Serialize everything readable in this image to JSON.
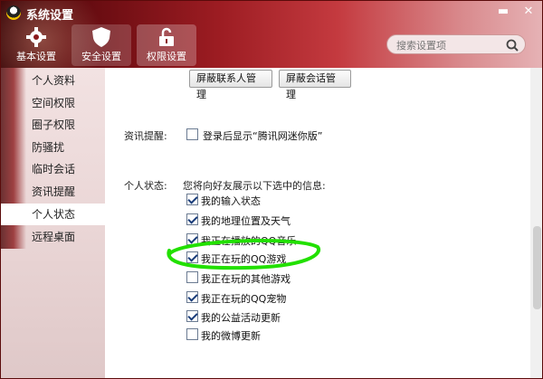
{
  "window": {
    "title": "系统设置"
  },
  "controls": {
    "minimize": "▬",
    "close": "✕"
  },
  "topnav": [
    {
      "label": "基本设置",
      "icon": "gear-icon"
    },
    {
      "label": "安全设置",
      "icon": "shield-icon"
    },
    {
      "label": "权限设置",
      "icon": "lock-icon"
    }
  ],
  "search": {
    "placeholder": "搜索设置项",
    "icon": "search-icon"
  },
  "sidebar": {
    "items": [
      {
        "label": "个人资料"
      },
      {
        "label": "空间权限"
      },
      {
        "label": "圈子权限"
      },
      {
        "label": "防骚扰"
      },
      {
        "label": "临时会话"
      },
      {
        "label": "资讯提醒"
      },
      {
        "label": "个人状态",
        "active": true
      },
      {
        "label": "远程桌面"
      }
    ]
  },
  "content": {
    "buttons": {
      "block_contacts": "屏蔽联系人管理",
      "block_sessions": "屏蔽会话管理"
    },
    "news_reminder": {
      "label": "资讯提醒:",
      "option": {
        "text": "登录后显示“腾讯网迷你版”",
        "checked": false
      }
    },
    "personal_status": {
      "label": "个人状态:",
      "description": "您将向好友展示以下选中的信息:",
      "options": [
        {
          "text": "我的输入状态",
          "checked": true
        },
        {
          "text": "我的地理位置及天气",
          "checked": true
        },
        {
          "text": "我正在播放的QQ音乐",
          "checked": true
        },
        {
          "text": "我正在玩的QQ游戏",
          "checked": true
        },
        {
          "text": "我正在玩的其他游戏",
          "checked": false
        },
        {
          "text": "我正在玩的QQ宠物",
          "checked": true
        },
        {
          "text": "我的公益活动更新",
          "checked": true
        },
        {
          "text": "我的微博更新",
          "checked": false
        }
      ]
    }
  },
  "colors": {
    "annotation": "#22e000",
    "header_dark": "#6b0d12",
    "header_light": "#e6b3b6"
  }
}
